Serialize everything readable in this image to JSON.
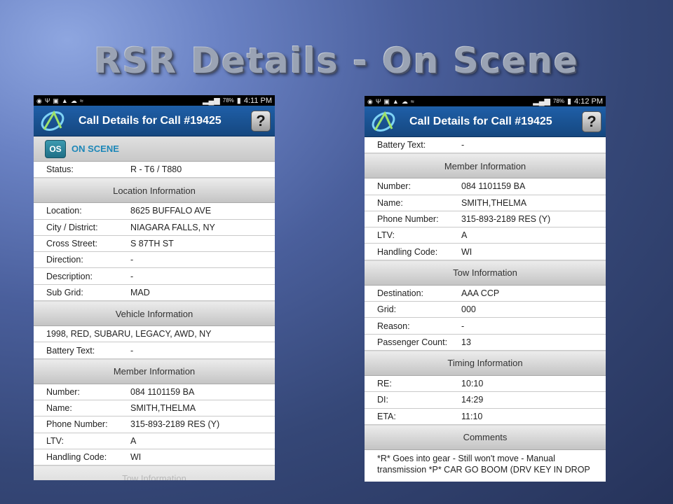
{
  "slide": {
    "title": "RSR Details - On Scene"
  },
  "phones": [
    {
      "status_time": "4:11 PM",
      "battery": "78%",
      "header_title": "Call Details for Call #19425",
      "help_label": "?",
      "os_badge": "OS",
      "os_label": "ON SCENE",
      "status_row": {
        "label": "Status:",
        "value": "R - T6 / T880"
      },
      "location": {
        "header": "Location Information",
        "rows": [
          {
            "label": "Location:",
            "value": "8625 BUFFALO AVE"
          },
          {
            "label": "City / District:",
            "value": "NIAGARA FALLS, NY"
          },
          {
            "label": "Cross Street:",
            "value": "S 87TH ST"
          },
          {
            "label": "Direction:",
            "value": "-"
          },
          {
            "label": "Description:",
            "value": "-"
          },
          {
            "label": "Sub Grid:",
            "value": "MAD"
          }
        ]
      },
      "vehicle": {
        "header": "Vehicle Information",
        "description": "1998, RED, SUBARU, LEGACY, AWD, NY",
        "battery_label": "Battery Text:",
        "battery_value": "-"
      },
      "member": {
        "header": "Member Information",
        "rows": [
          {
            "label": "Number:",
            "value": "084 1101159 BA"
          },
          {
            "label": "Name:",
            "value": "SMITH,THELMA"
          },
          {
            "label": "Phone Number:",
            "value": "315-893-2189 RES  (Y)"
          },
          {
            "label": "LTV:",
            "value": "A"
          },
          {
            "label": "Handling Code:",
            "value": "WI"
          }
        ]
      },
      "tow_header_partial": "Tow Information"
    },
    {
      "status_time": "4:12 PM",
      "battery": "78%",
      "header_title": "Call Details for Call #19425",
      "help_label": "?",
      "battery_row": {
        "label": "Battery Text:",
        "value": "-"
      },
      "member": {
        "header": "Member Information",
        "rows": [
          {
            "label": "Number:",
            "value": "084 1101159 BA"
          },
          {
            "label": "Name:",
            "value": "SMITH,THELMA"
          },
          {
            "label": "Phone Number:",
            "value": "315-893-2189 RES  (Y)"
          },
          {
            "label": "LTV:",
            "value": "A"
          },
          {
            "label": "Handling Code:",
            "value": "WI"
          }
        ]
      },
      "tow": {
        "header": "Tow Information",
        "rows": [
          {
            "label": "Destination:",
            "value": "AAA CCP"
          },
          {
            "label": "Grid:",
            "value": "000"
          },
          {
            "label": "Reason:",
            "value": "-"
          },
          {
            "label": "Passenger Count:",
            "value": "13"
          }
        ]
      },
      "timing": {
        "header": "Timing Information",
        "rows": [
          {
            "label": "RE:",
            "value": "10:10"
          },
          {
            "label": "DI:",
            "value": "14:29"
          },
          {
            "label": "ETA:",
            "value": "11:10"
          }
        ]
      },
      "comments": {
        "header": "Comments",
        "lines": [
          "*R* Goes into gear - Still won't move - Manual",
          "transmission *P* CAR GO BOOM (DRV KEY IN DROP"
        ]
      }
    }
  ],
  "colors": {
    "appbar": "#1f5fa8",
    "os_accent": "#1d87b8"
  },
  "icons": [
    "location-icon",
    "usb-icon",
    "image-icon",
    "warning-icon",
    "cloud-upload-icon",
    "wifi-icon",
    "signal-icon",
    "battery-icon",
    "app-logo-icon",
    "help-icon"
  ]
}
